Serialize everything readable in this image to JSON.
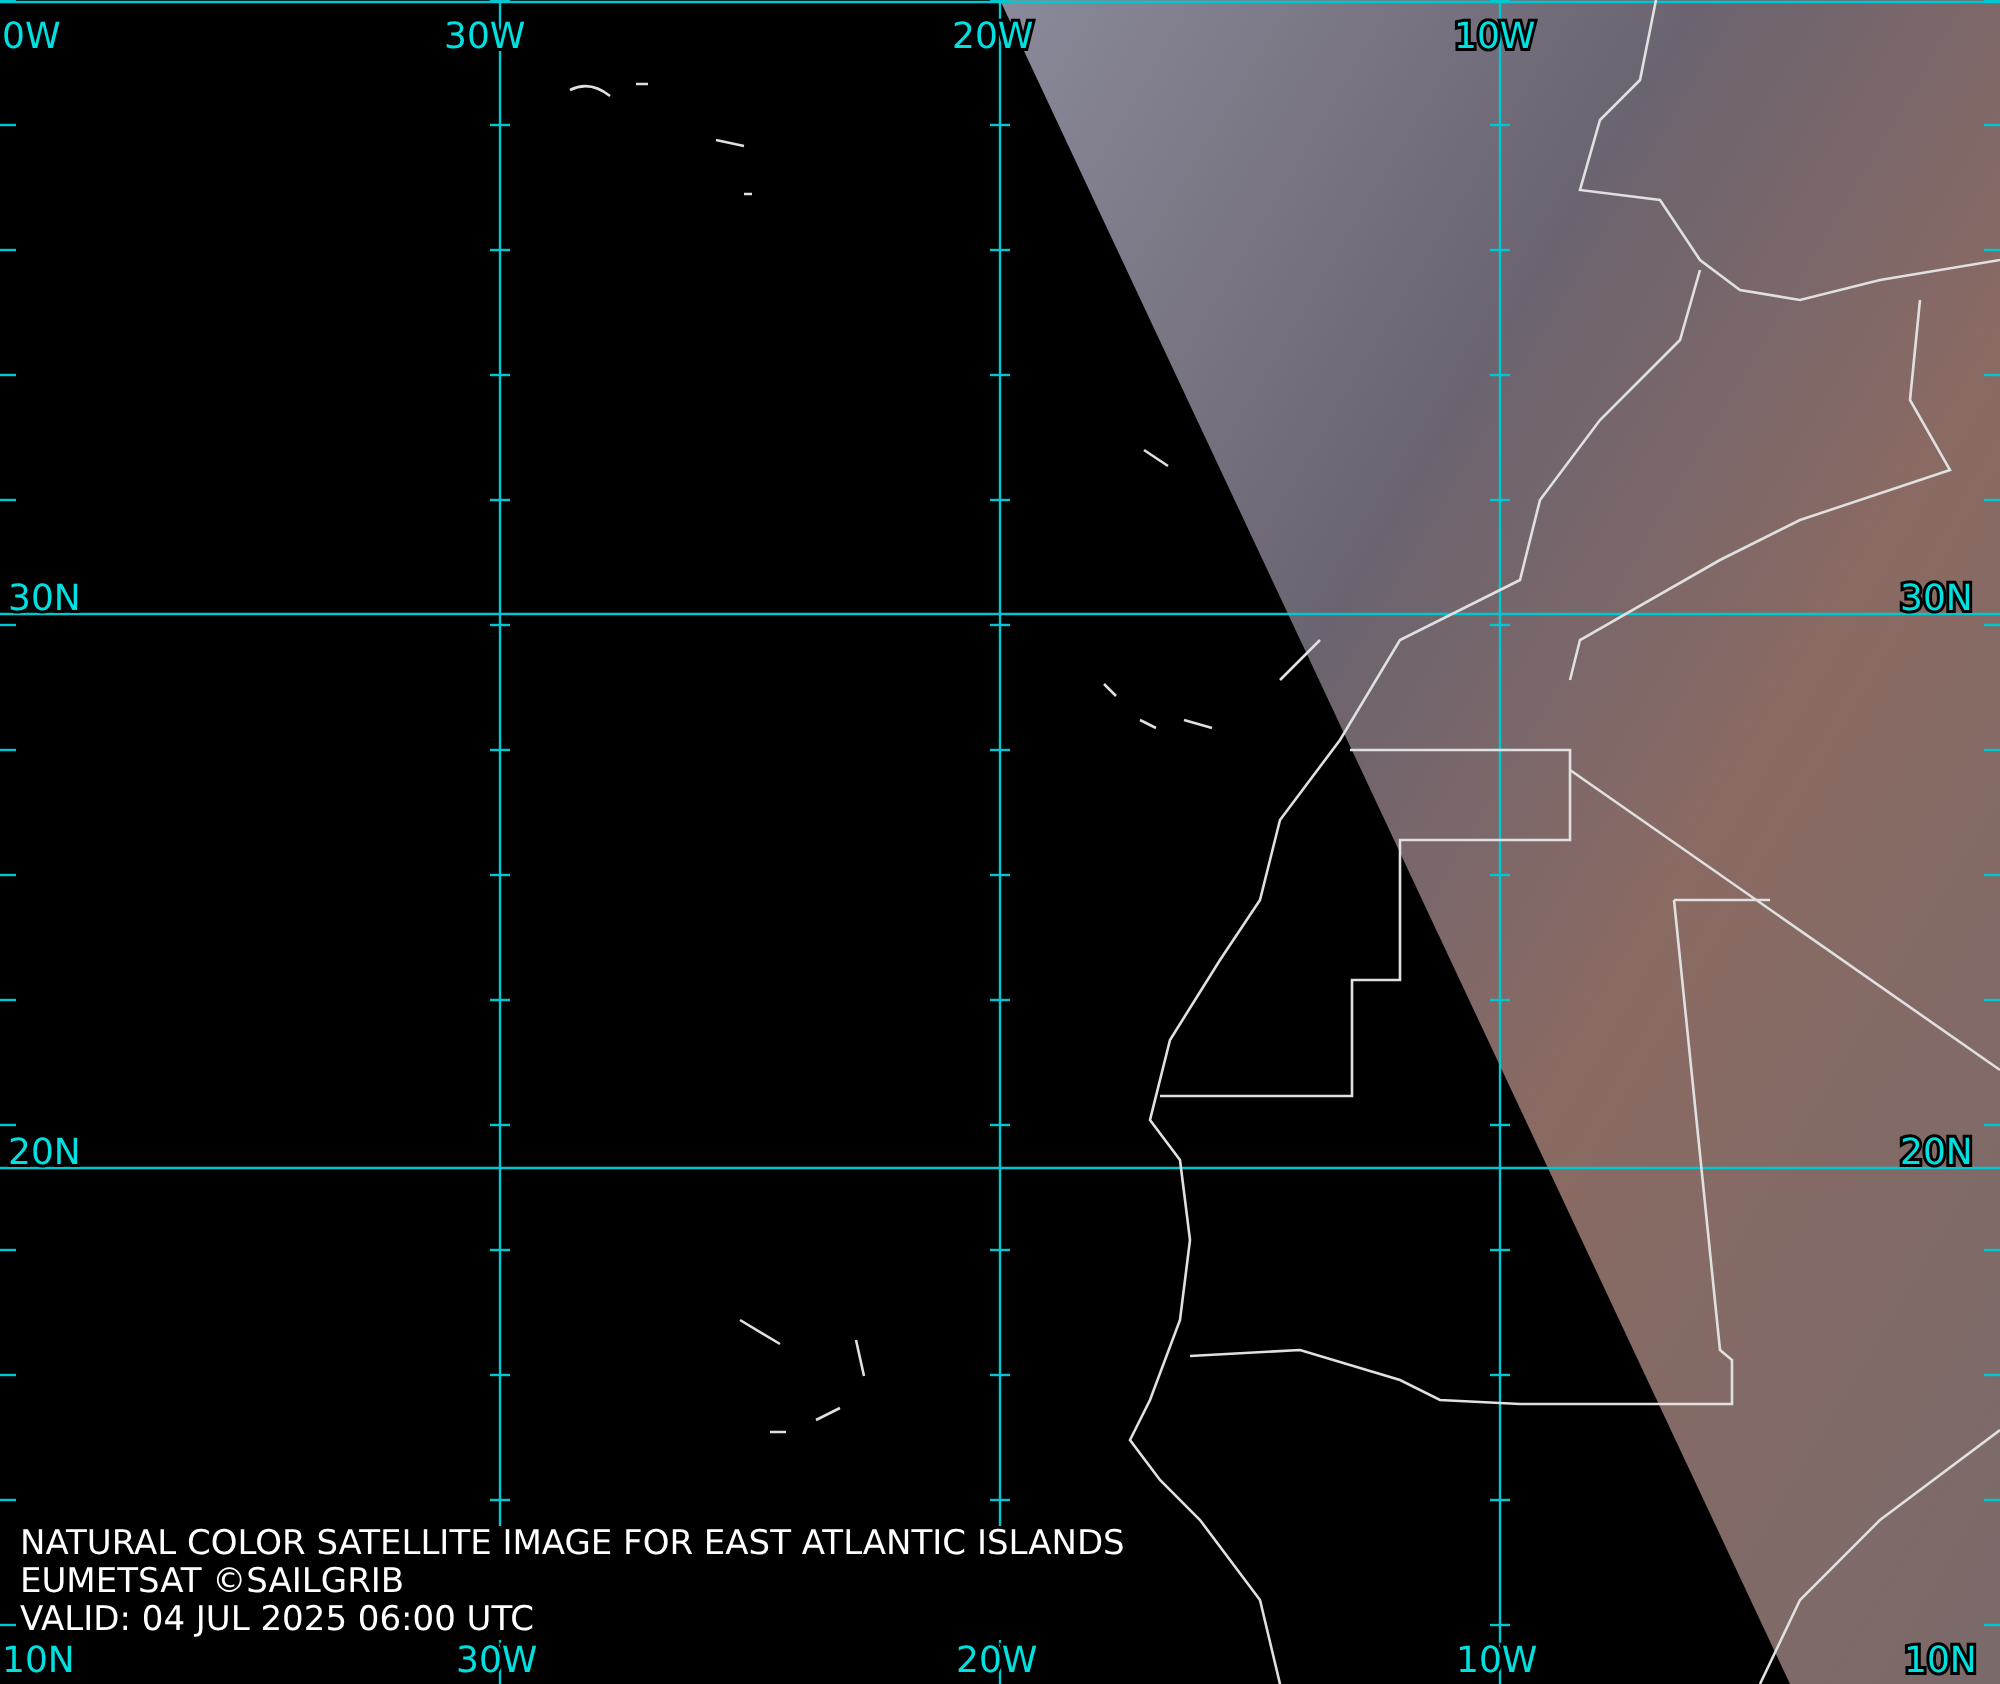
{
  "map": {
    "longitude_labels_top": [
      "0W",
      "30W",
      "20W",
      "10W"
    ],
    "longitude_labels_bottom": [
      "10N",
      "30W",
      "20W",
      "10W",
      "10N"
    ],
    "latitude_labels_left": [
      "30N",
      "20N"
    ],
    "latitude_labels_right": [
      "30N",
      "20N"
    ]
  },
  "caption": {
    "title": "NATURAL COLOR SATELLITE IMAGE FOR EAST ATLANTIC ISLANDS",
    "credit": "EUMETSAT ©SAILGRIB",
    "valid": "VALID:  04 JUL 2025 06:00 UTC"
  }
}
